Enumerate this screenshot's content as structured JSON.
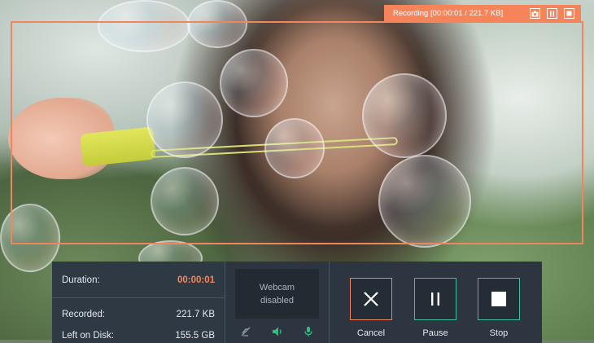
{
  "recording_bar": {
    "status_text": "Recording [00:00:01 / 221.7 KB]",
    "buttons": [
      {
        "name": "screenshot",
        "icon": "camera-icon"
      },
      {
        "name": "pause",
        "icon": "pause-icon"
      },
      {
        "name": "stop",
        "icon": "stop-icon"
      }
    ]
  },
  "stats": {
    "duration_label": "Duration:",
    "duration_value": "00:00:01",
    "recorded_label": "Recorded:",
    "recorded_value": "221.7 KB",
    "disk_label": "Left on Disk:",
    "disk_value": "155.5 GB"
  },
  "webcam": {
    "line1": "Webcam",
    "line2": "disabled",
    "icons": [
      "webcam-off-icon",
      "speaker-icon",
      "microphone-icon"
    ]
  },
  "actions": {
    "cancel_label": "Cancel",
    "pause_label": "Pause",
    "stop_label": "Stop"
  },
  "colors": {
    "accent": "#f5845b",
    "active": "#3fbf9c",
    "panel": "#2c3540"
  }
}
